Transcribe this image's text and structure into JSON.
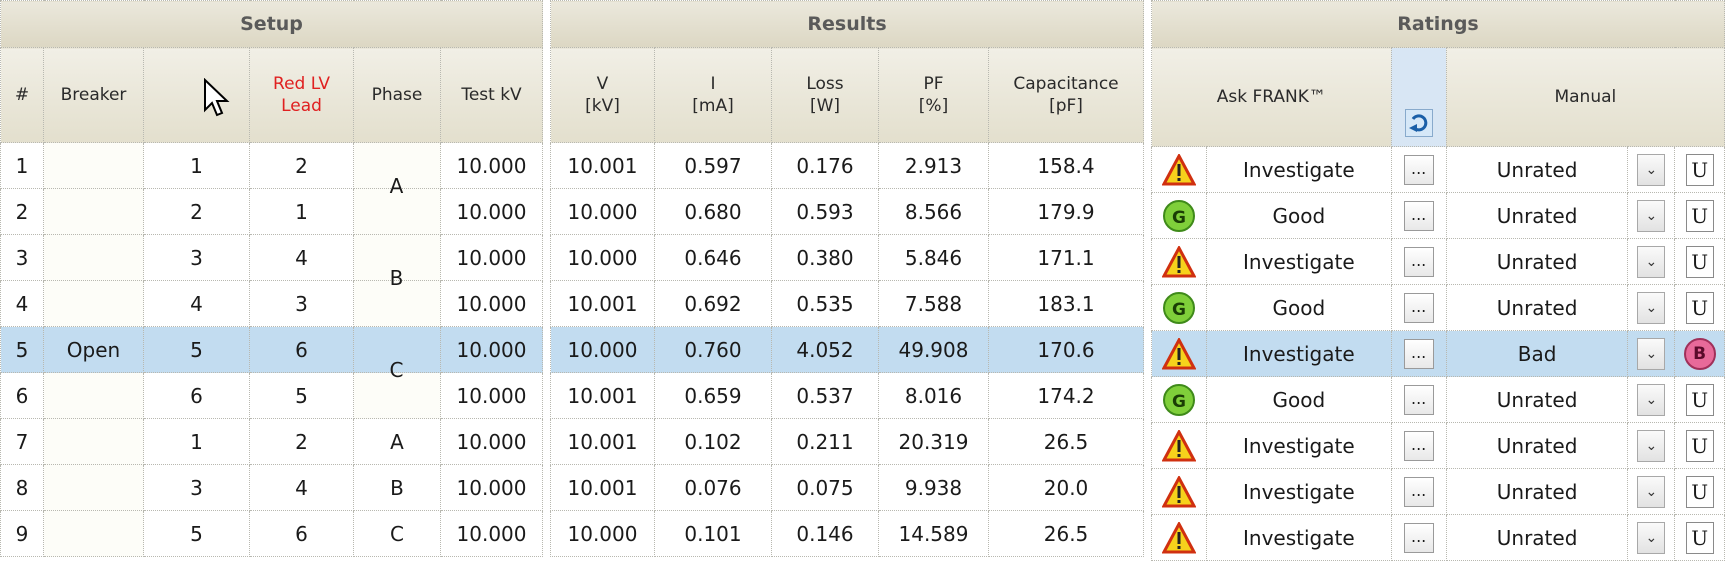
{
  "sections": {
    "setup": "Setup",
    "results": "Results",
    "ratings": "Ratings"
  },
  "columns": {
    "num": "#",
    "breaker": "Breaker",
    "hv_lead": "",
    "red_lv_line1": "Red LV",
    "red_lv_line2": "Lead",
    "phase": "Phase",
    "test_kv": "Test kV",
    "v_line1": "V",
    "v_line2": "[kV]",
    "i_line1": "I",
    "i_line2": "[mA]",
    "loss_line1": "Loss",
    "loss_line2": "[W]",
    "pf_line1": "PF",
    "pf_line2": "[%]",
    "cap_line1": "Capacitance",
    "cap_line2": "[pF]",
    "ask_frank": "Ask FRANK™",
    "manual": "Manual"
  },
  "breaker_value": "Open",
  "phase_groups": [
    {
      "label": "A"
    },
    {
      "label": "B"
    },
    {
      "label": "C"
    }
  ],
  "rows": [
    {
      "num": "1",
      "hv": "1",
      "lv": "2",
      "phase": "",
      "test_kv": "10.000",
      "v": "10.001",
      "i": "0.597",
      "loss": "0.176",
      "pf": "2.913",
      "cap": "158.4",
      "frank_icon": "warning-icon",
      "frank": "Investigate",
      "ellipsis": "...",
      "manual": "Unrated",
      "rating_btn": "U"
    },
    {
      "num": "2",
      "hv": "2",
      "lv": "1",
      "phase": "",
      "test_kv": "10.000",
      "v": "10.000",
      "i": "0.680",
      "loss": "0.593",
      "pf": "8.566",
      "cap": "179.9",
      "frank_icon": "good-icon",
      "frank": "Good",
      "ellipsis": "...",
      "manual": "Unrated",
      "rating_btn": "U"
    },
    {
      "num": "3",
      "hv": "3",
      "lv": "4",
      "phase": "",
      "test_kv": "10.000",
      "v": "10.000",
      "i": "0.646",
      "loss": "0.380",
      "pf": "5.846",
      "cap": "171.1",
      "frank_icon": "warning-icon",
      "frank": "Investigate",
      "ellipsis": "...",
      "manual": "Unrated",
      "rating_btn": "U"
    },
    {
      "num": "4",
      "hv": "4",
      "lv": "3",
      "phase": "",
      "test_kv": "10.000",
      "v": "10.001",
      "i": "0.692",
      "loss": "0.535",
      "pf": "7.588",
      "cap": "183.1",
      "frank_icon": "good-icon",
      "frank": "Good",
      "ellipsis": "...",
      "manual": "Unrated",
      "rating_btn": "U"
    },
    {
      "num": "5",
      "hv": "5",
      "lv": "6",
      "phase": "",
      "test_kv": "10.000",
      "v": "10.000",
      "i": "0.760",
      "loss": "4.052",
      "pf": "49.908",
      "cap": "170.6",
      "frank_icon": "warning-icon",
      "frank": "Investigate",
      "ellipsis": "...",
      "manual": "Bad",
      "rating_btn": "B"
    },
    {
      "num": "6",
      "hv": "6",
      "lv": "5",
      "phase": "",
      "test_kv": "10.000",
      "v": "10.001",
      "i": "0.659",
      "loss": "0.537",
      "pf": "8.016",
      "cap": "174.2",
      "frank_icon": "good-icon",
      "frank": "Good",
      "ellipsis": "...",
      "manual": "Unrated",
      "rating_btn": "U"
    },
    {
      "num": "7",
      "hv": "1",
      "lv": "2",
      "phase": "A",
      "test_kv": "10.000",
      "v": "10.001",
      "i": "0.102",
      "loss": "0.211",
      "pf": "20.319",
      "cap": "26.5",
      "frank_icon": "warning-icon",
      "frank": "Investigate",
      "ellipsis": "...",
      "manual": "Unrated",
      "rating_btn": "U"
    },
    {
      "num": "8",
      "hv": "3",
      "lv": "4",
      "phase": "B",
      "test_kv": "10.000",
      "v": "10.001",
      "i": "0.076",
      "loss": "0.075",
      "pf": "9.938",
      "cap": "20.0",
      "frank_icon": "warning-icon",
      "frank": "Investigate",
      "ellipsis": "...",
      "manual": "Unrated",
      "rating_btn": "U"
    },
    {
      "num": "9",
      "hv": "5",
      "lv": "6",
      "phase": "C",
      "test_kv": "10.000",
      "v": "10.000",
      "i": "0.101",
      "loss": "0.146",
      "pf": "14.589",
      "cap": "26.5",
      "frank_icon": "warning-icon",
      "frank": "Investigate",
      "ellipsis": "...",
      "manual": "Unrated",
      "rating_btn": "U"
    }
  ],
  "selected_row": 5,
  "colors": {
    "selected": "#c2dcf0",
    "red_header": "#e02020",
    "warning": "#f6d21c",
    "good": "#7fcf3a",
    "bad": "#e86a9a"
  }
}
